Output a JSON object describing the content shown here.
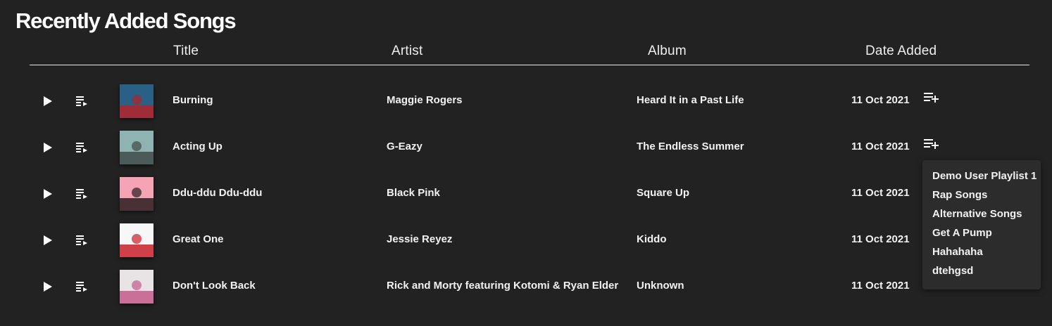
{
  "page": {
    "title": "Recently Added Songs"
  },
  "columns": {
    "title": "Title",
    "artist": "Artist",
    "album": "Album",
    "date_added": "Date Added"
  },
  "icons": {
    "play": "play-icon",
    "queue": "queue-music-icon",
    "add_to_playlist": "playlist-add-icon"
  },
  "songs": [
    {
      "title": "Burning",
      "artist": "Maggie Rogers",
      "album": "Heard It in a Past Life",
      "date_added": "11 Oct 2021",
      "art_colors": [
        "#2a5f86",
        "#b3242a"
      ]
    },
    {
      "title": "Acting Up",
      "artist": "G-Eazy",
      "album": "The Endless Summer",
      "date_added": "11 Oct 2021",
      "art_colors": [
        "#8fb3b0",
        "#3e4b4a"
      ]
    },
    {
      "title": "Ddu-ddu Ddu-ddu",
      "artist": "Black Pink",
      "album": "Square Up",
      "date_added": "11 Oct 2021",
      "art_colors": [
        "#f4a4b4",
        "#2a1c1f"
      ]
    },
    {
      "title": "Great One",
      "artist": "Jessie Reyez",
      "album": "Kiddo",
      "date_added": "11 Oct 2021",
      "art_colors": [
        "#f7f7f7",
        "#c8202a"
      ]
    },
    {
      "title": "Don't Look Back",
      "artist": "Rick and Morty featuring Kotomi & Ryan Elder",
      "album": "Unknown",
      "date_added": "11 Oct 2021",
      "art_colors": [
        "#e8e4e6",
        "#c45a8a"
      ]
    }
  ],
  "playlist_menu": {
    "items": [
      "Demo User Playlist 1",
      "Rap Songs",
      "Alternative Songs",
      "Get A Pump",
      "Hahahaha",
      "dtehgsd"
    ]
  }
}
